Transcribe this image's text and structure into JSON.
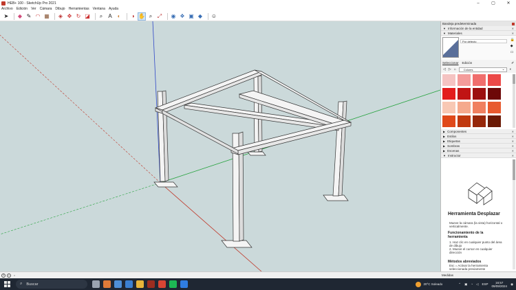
{
  "window": {
    "title": "HEB+ 100 - SketchUp Pro 2021",
    "min": "–",
    "max": "▢",
    "close": "✕"
  },
  "menu": [
    "Archivo",
    "Edición",
    "Ver",
    "Cámara",
    "Dibujo",
    "Herramientas",
    "Ventana",
    "Ayuda"
  ],
  "toolbar": [
    "select-icon",
    "eraser-icon",
    "pencil-icon",
    "arc-icon",
    "rectangle-icon",
    "push-pull-icon",
    "move-icon",
    "rotate-icon",
    "scale-icon",
    "offset-icon",
    "tape-measure-icon",
    "text-icon",
    "paint-bucket-icon",
    "orbit-icon",
    "pan-icon",
    "zoom-icon",
    "zoom-extents-icon",
    "warehouse-icon",
    "extension-icon",
    "layout-icon",
    "ruby-icon",
    "user-icon"
  ],
  "tray": {
    "title": "Bandeja predeterminada",
    "entity_info": "Información de la entidad",
    "materials": "Materiales",
    "material_name": "Por defecto",
    "tab_select": "Seleccionar",
    "tab_edit": "Edición",
    "collection": "Colores",
    "swatches": [
      "#f5c3c2",
      "#f49c9b",
      "#f06e6d",
      "#ec4948",
      "#e31c1c",
      "#c01414",
      "#9c0f0f",
      "#6d0808",
      "#f8c8b4",
      "#f5a98d",
      "#f08060",
      "#e85a2e",
      "#e0491a",
      "#c0390f",
      "#96270a",
      "#6a1a05"
    ],
    "components": "Componentes",
    "styles": "Estilos",
    "tags": "Etiquetas",
    "shadows": "Sombras",
    "scenes": "Escenas",
    "instructor": "Instructor",
    "instr_title": "Herramienta Desplazar",
    "instr_sub": "Mueve la cámara (la vista) horizontal o verticalmente.",
    "instr_h2": "Funcionamiento de la herramienta",
    "instr_step1": "1. Haz clic en cualquier punto del área de dibujo",
    "instr_step2": "2. Mueve el cursor en cualquier dirección",
    "instr_h3": "Métodos abreviados",
    "instr_esc": "Esc = Activar la herramienta seleccionada previamente"
  },
  "status": {
    "measures": "Medidas"
  },
  "taskbar": {
    "search": "Buscar",
    "weather": "20°C  Soleado",
    "lang": "ESP",
    "time": "16:57",
    "date": "09/09/2024",
    "apps": [
      "#9aa3b0",
      "#e07b39",
      "#4f8fd6",
      "#3b7fd0",
      "#e8b53a",
      "#9b2d20",
      "#d84534",
      "#1db954",
      "#2f7de1"
    ]
  },
  "colors": {
    "viewport": "#cbd9da",
    "axis_red": "#c0392b",
    "axis_green": "#27a33f",
    "axis_blue": "#2f47c7"
  }
}
